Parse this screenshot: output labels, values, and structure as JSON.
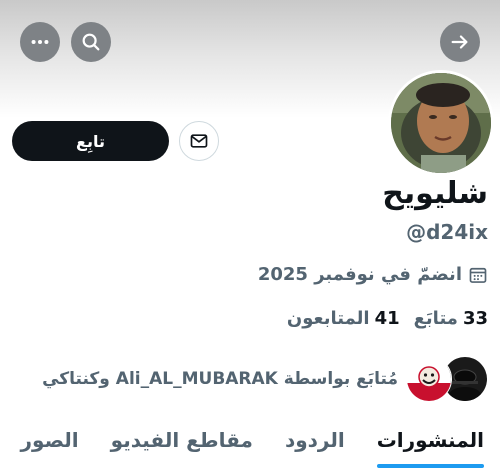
{
  "header": {
    "back_icon": "arrow-right-icon",
    "search_icon": "search-icon",
    "more_icon": "more-horizontal-icon"
  },
  "profile": {
    "display_name": "شليويح",
    "handle": "@d24ix",
    "joined": "انضمّ في نوفمبر 2025",
    "calendar_icon": "calendar-icon",
    "follow_label": "تابِع",
    "message_icon": "envelope-icon"
  },
  "stats": {
    "following_count": "33",
    "following_label": "متابَع",
    "followers_count": "41",
    "followers_label": "المتابعون"
  },
  "followed_by": {
    "text": "مُتابَع بواسطة Ali_AL_MUBARAK وكنتاكي"
  },
  "tabs": [
    {
      "label": "المنشورات",
      "active": true
    },
    {
      "label": "الردود",
      "active": false
    },
    {
      "label": "مقاطع الفيديو",
      "active": false
    },
    {
      "label": "الصور",
      "active": false
    }
  ],
  "colors": {
    "accent": "#1d9bf0",
    "text_primary": "#0f1419",
    "text_secondary": "#536471"
  }
}
